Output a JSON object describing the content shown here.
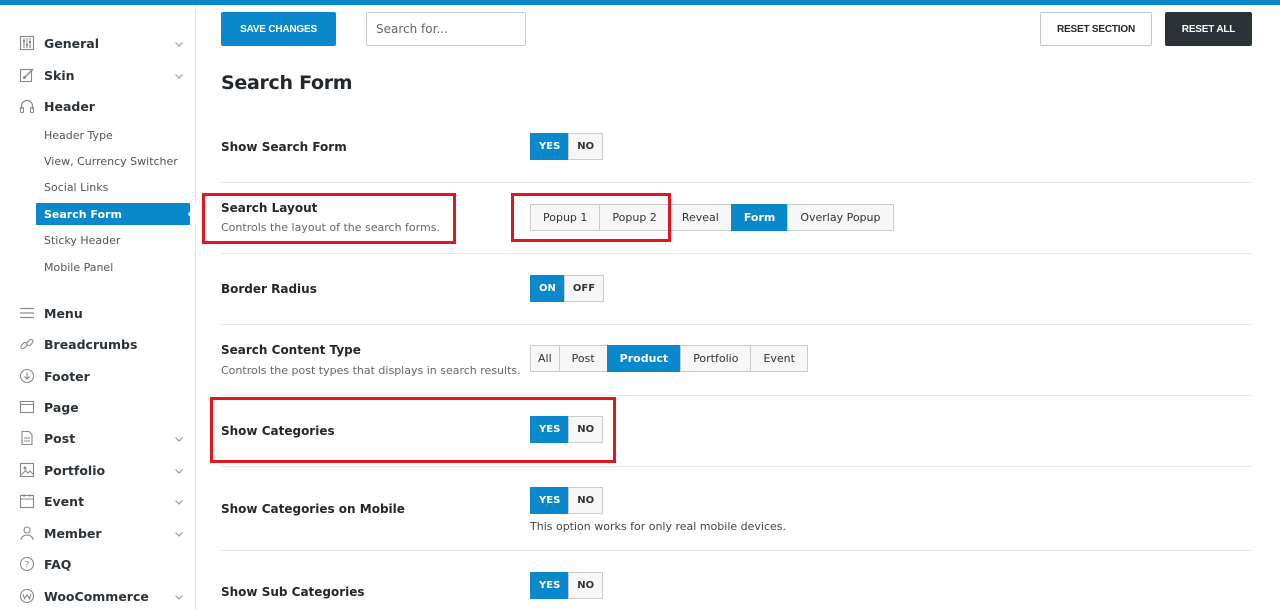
{
  "sidebar": {
    "items": [
      {
        "label": "General",
        "icon": "sliders-icon",
        "chevron": true
      },
      {
        "label": "Skin",
        "icon": "brush-icon",
        "chevron": true
      },
      {
        "label": "Header",
        "icon": "headphones-icon",
        "chevron": false
      },
      {
        "label": "Menu",
        "icon": "menu-icon",
        "chevron": false
      },
      {
        "label": "Breadcrumbs",
        "icon": "link-icon",
        "chevron": false
      },
      {
        "label": "Footer",
        "icon": "arrow-down-circle-icon",
        "chevron": false
      },
      {
        "label": "Page",
        "icon": "window-icon",
        "chevron": false
      },
      {
        "label": "Post",
        "icon": "document-icon",
        "chevron": true
      },
      {
        "label": "Portfolio",
        "icon": "portfolio-icon",
        "chevron": true
      },
      {
        "label": "Event",
        "icon": "calendar-icon",
        "chevron": true
      },
      {
        "label": "Member",
        "icon": "user-icon",
        "chevron": true
      },
      {
        "label": "FAQ",
        "icon": "question-icon",
        "chevron": false
      },
      {
        "label": "WooCommerce",
        "icon": "woocommerce-icon",
        "chevron": true
      }
    ],
    "header_sub": [
      "Header Type",
      "View, Currency Switcher",
      "Social Links",
      "Search Form",
      "Sticky Header",
      "Mobile Panel"
    ],
    "active_sub": "Search Form"
  },
  "toolbar": {
    "save_label": "SAVE CHANGES",
    "search_placeholder": "Search for...",
    "reset_section_label": "RESET SECTION",
    "reset_all_label": "RESET ALL"
  },
  "page": {
    "title": "Search Form"
  },
  "settings": {
    "show_search_form": {
      "title": "Show Search Form",
      "options": [
        "YES",
        "NO"
      ],
      "selected": "YES"
    },
    "search_layout": {
      "title": "Search Layout",
      "desc": "Controls the layout of the search forms.",
      "options": [
        "Popup 1",
        "Popup 2",
        "Reveal",
        "Form",
        "Overlay Popup"
      ],
      "selected": "Form"
    },
    "border_radius": {
      "title": "Border Radius",
      "options": [
        "ON",
        "OFF"
      ],
      "selected": "ON"
    },
    "search_content_type": {
      "title": "Search Content Type",
      "desc": "Controls the post types that displays in search results.",
      "options": [
        "All",
        "Post",
        "Product",
        "Portfolio",
        "Event"
      ],
      "selected": "Product"
    },
    "show_categories": {
      "title": "Show Categories",
      "options": [
        "YES",
        "NO"
      ],
      "selected": "YES"
    },
    "show_categories_mobile": {
      "title": "Show Categories on Mobile",
      "options": [
        "YES",
        "NO"
      ],
      "selected": "YES",
      "note": "This option works for only real mobile devices."
    },
    "show_sub_categories": {
      "title": "Show Sub Categories",
      "options": [
        "YES",
        "NO"
      ],
      "selected": "YES"
    }
  },
  "colors": {
    "accent": "#0a88cc",
    "highlight": "#e2141e",
    "dark_button": "#2c3338"
  }
}
